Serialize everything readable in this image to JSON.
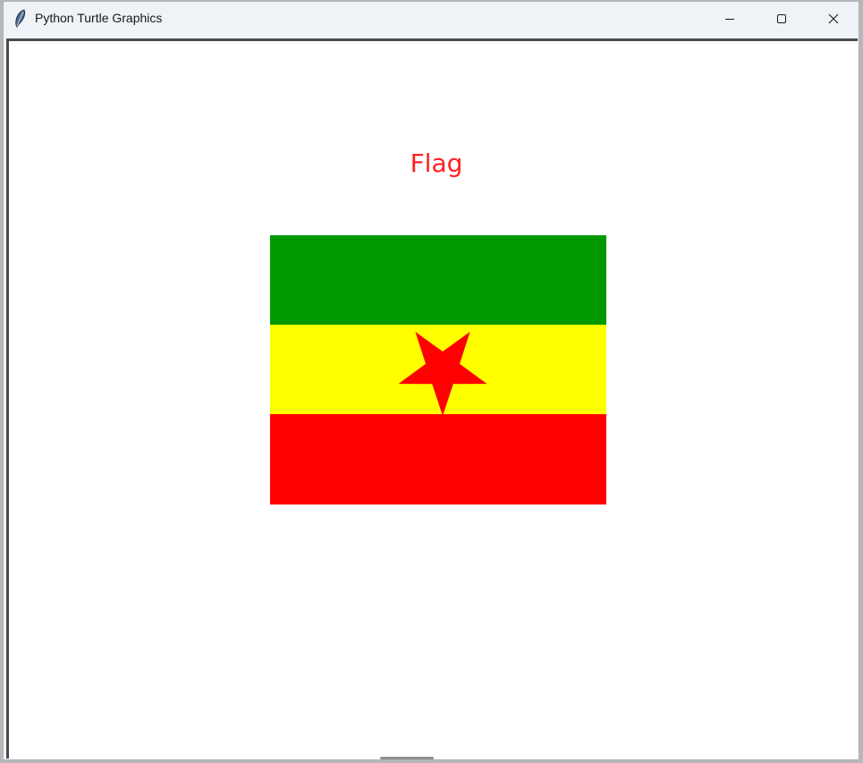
{
  "window": {
    "title": "Python Turtle Graphics",
    "icon": "feather-icon",
    "controls": {
      "minimize": "minimize-icon",
      "maximize": "maximize-icon",
      "close": "close-icon"
    }
  },
  "canvas": {
    "background": "#ffffff",
    "heading": {
      "text": "Flag",
      "color": "#ff2020"
    },
    "flag": {
      "stripes": [
        {
          "name": "green",
          "color": "#009900"
        },
        {
          "name": "yellow",
          "color": "#ffff00"
        },
        {
          "name": "red",
          "color": "#ff0000"
        }
      ],
      "star": {
        "color": "#ff0000",
        "points": 5
      }
    }
  }
}
